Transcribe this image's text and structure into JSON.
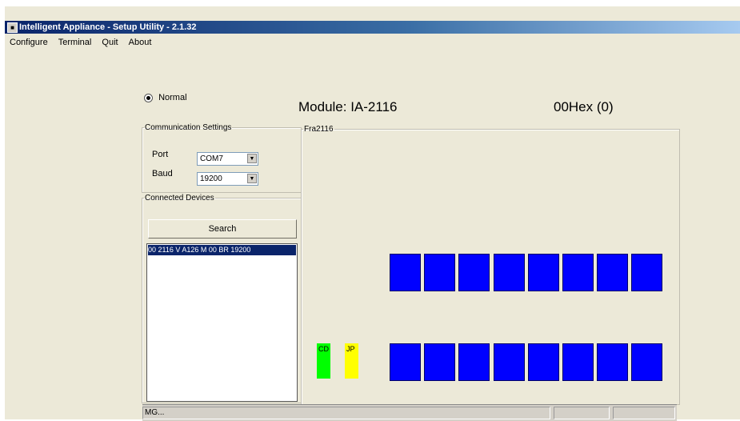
{
  "window": {
    "title": "Intelligent Appliance - Setup Utility - 2.1.32"
  },
  "menu": [
    {
      "label": "Configure"
    },
    {
      "label": "Terminal"
    },
    {
      "label": "Quit"
    },
    {
      "label": "About"
    }
  ],
  "mode": {
    "label": "Normal",
    "selected": true
  },
  "module_title": "Module: IA-2116",
  "hex_title": "00Hex (0)",
  "comm": {
    "legend": "Communication Settings",
    "port_label": "Port",
    "port_value": "COM7",
    "baud_label": "Baud",
    "baud_value": "19200"
  },
  "devices": {
    "legend": "Connected Devices",
    "search_label": "Search",
    "items": [
      "00 2116 V A126 M 00 BR 19200"
    ]
  },
  "frame": {
    "legend": "Fra2116",
    "indicators": [
      {
        "label": "CD",
        "color": "#00ff00"
      },
      {
        "label": "JP",
        "color": "#ffff00"
      }
    ],
    "led_color": "#0000ff",
    "top_row_count": 8,
    "bottom_row_count": 8
  },
  "status": {
    "text": "MG..."
  }
}
